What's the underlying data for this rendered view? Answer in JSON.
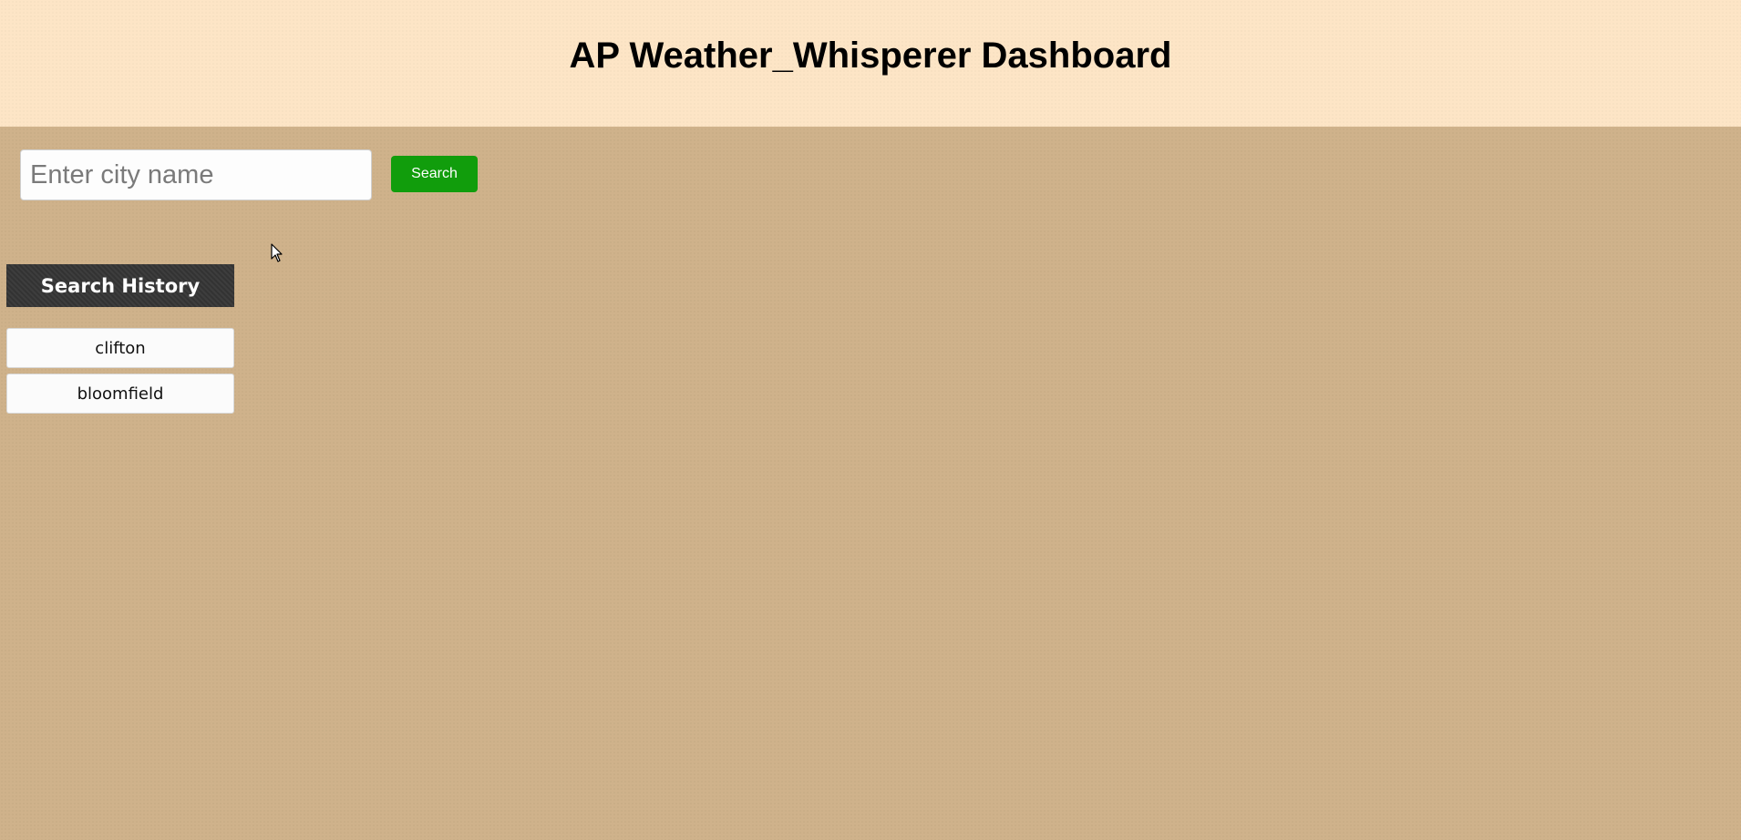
{
  "header": {
    "title": "AP Weather_Whisperer Dashboard"
  },
  "search": {
    "placeholder": "Enter city name",
    "value": "",
    "button_label": "Search"
  },
  "history": {
    "title": "Search History",
    "items": [
      {
        "label": "clifton"
      },
      {
        "label": "bloomfield"
      }
    ]
  },
  "colors": {
    "page_background": "#cfb28b",
    "header_background": "#fde5c6",
    "search_button": "#119d0c",
    "history_title_background": "#333333"
  },
  "icons": {
    "cursor": "mouse-pointer-icon"
  }
}
